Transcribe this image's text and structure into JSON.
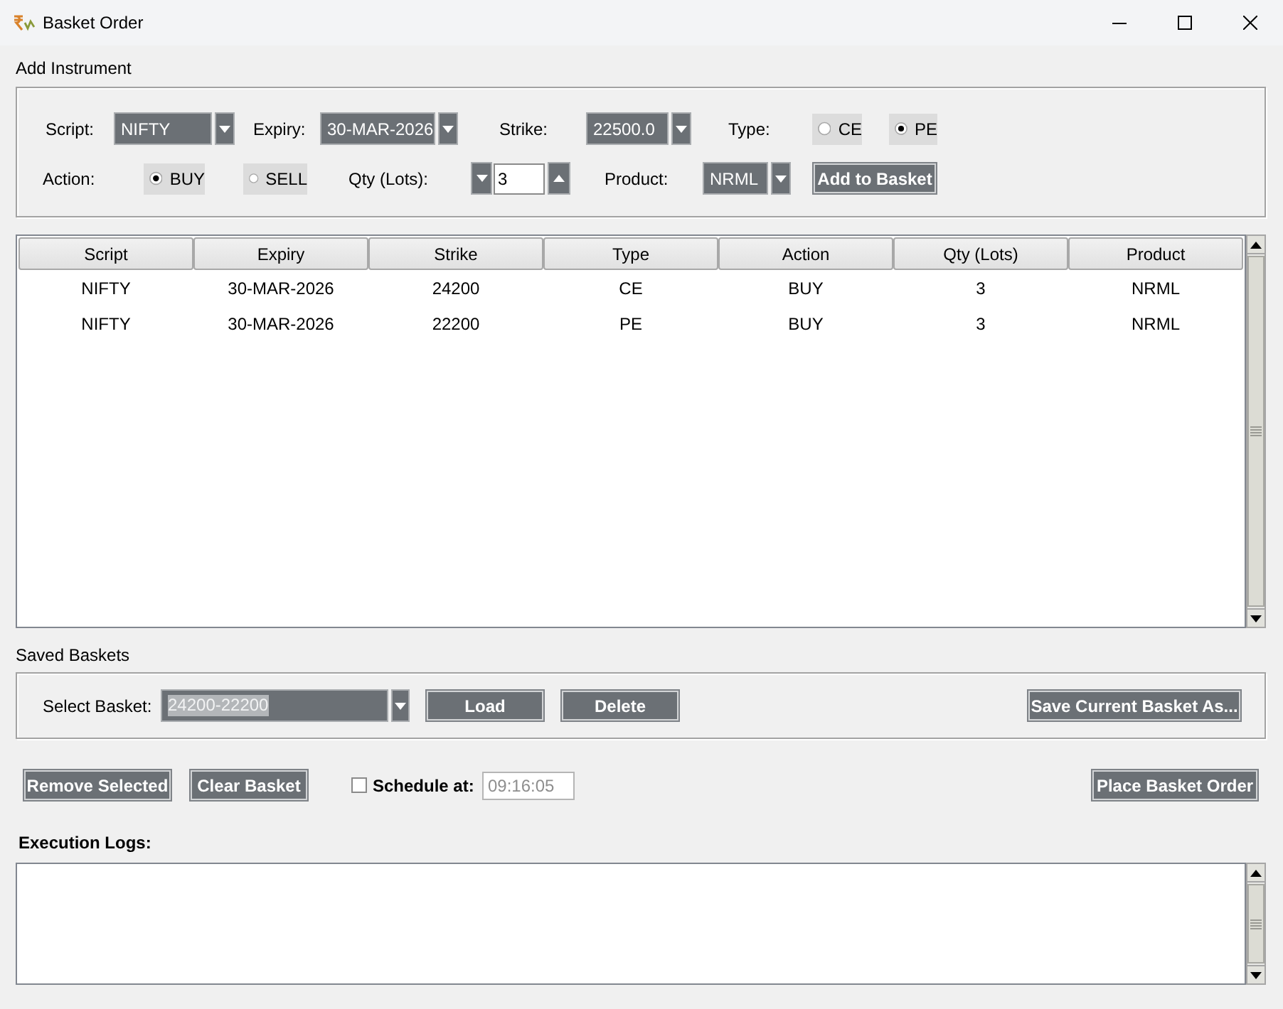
{
  "window": {
    "title": "Basket Order"
  },
  "add_instrument": {
    "title": "Add Instrument",
    "script": {
      "label": "Script:",
      "value": "NIFTY"
    },
    "expiry": {
      "label": "Expiry:",
      "value": "30-MAR-2026"
    },
    "strike": {
      "label": "Strike:",
      "value": "22500.0"
    },
    "type": {
      "label": "Type:",
      "options": [
        {
          "label": "CE",
          "selected": false
        },
        {
          "label": "PE",
          "selected": true
        }
      ]
    },
    "action": {
      "label": "Action:",
      "options": [
        {
          "label": "BUY",
          "selected": true
        },
        {
          "label": "SELL",
          "selected": false
        }
      ]
    },
    "qty": {
      "label": "Qty (Lots):",
      "value": "3"
    },
    "product": {
      "label": "Product:",
      "value": "NRML"
    },
    "add_button": "Add to Basket"
  },
  "table": {
    "columns": [
      "Script",
      "Expiry",
      "Strike",
      "Type",
      "Action",
      "Qty (Lots)",
      "Product"
    ],
    "rows": [
      [
        "NIFTY",
        "30-MAR-2026",
        "24200",
        "CE",
        "BUY",
        "3",
        "NRML"
      ],
      [
        "NIFTY",
        "30-MAR-2026",
        "22200",
        "PE",
        "BUY",
        "3",
        "NRML"
      ]
    ]
  },
  "saved_baskets": {
    "title": "Saved Baskets",
    "select": {
      "label": "Select Basket:",
      "value": "24200-22200",
      "highlighted": true
    },
    "buttons": [
      "Load",
      "Delete",
      "Save Current Basket As..."
    ]
  },
  "actions": {
    "buttons": [
      "Remove Selected",
      "Clear Basket"
    ],
    "schedule": {
      "label": "Schedule at:",
      "checked": false,
      "value": "09:16:05",
      "disabled": true
    },
    "place_button": "Place Basket Order"
  },
  "logs": {
    "title": "Execution Logs:"
  }
}
